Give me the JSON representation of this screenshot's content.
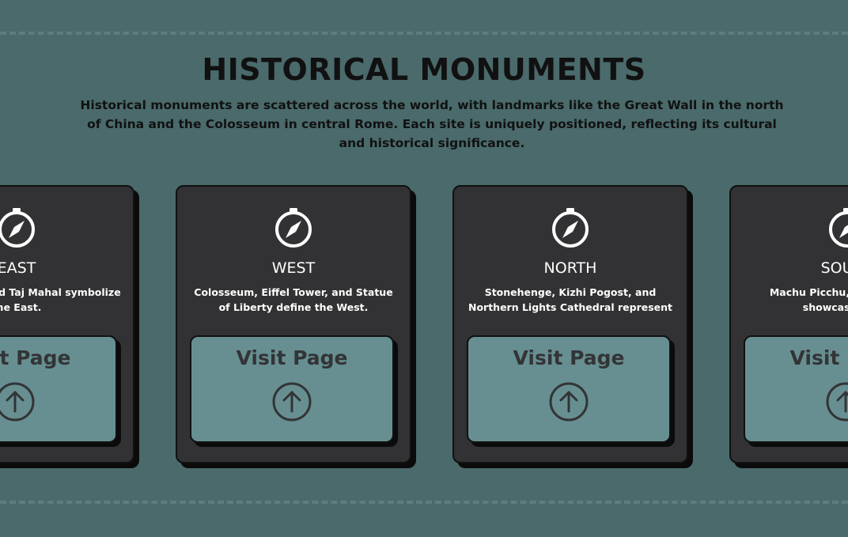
{
  "section": {
    "heading": "HISTORICAL MONUMENTS",
    "subtitle": "Historical monuments are scattered across the world, with landmarks like the Great Wall in the north of China and the Colosseum in central Rome. Each site is uniquely positioned, reflecting its cultural and historical significance."
  },
  "cards": [
    {
      "title": "EAST",
      "description": "Angkor Wat, and Taj Mahal symbolize the East.",
      "button_label": "Visit Page",
      "icon": "compass-icon"
    },
    {
      "title": "WEST",
      "description": "Colosseum, Eiffel Tower, and Statue of Liberty define the West.",
      "button_label": "Visit Page",
      "icon": "compass-icon"
    },
    {
      "title": "NORTH",
      "description": "Stonehenge, Kizhi Pogost, and Northern Lights Cathedral represent",
      "button_label": "Visit Page",
      "icon": "compass-icon"
    },
    {
      "title": "SOUTH",
      "description": "Machu Picchu, Moai statues showcase south",
      "button_label": "Visit Page",
      "icon": "compass-icon"
    }
  ],
  "colors": {
    "background": "#4a6a6b",
    "card": "#323234",
    "button": "#678f91",
    "text_dark": "#111111"
  }
}
